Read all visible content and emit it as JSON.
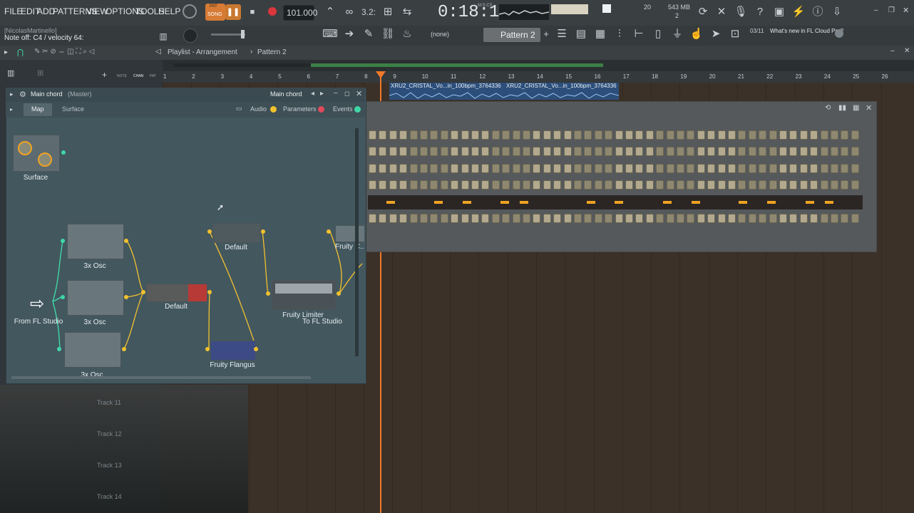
{
  "menu": [
    "FILE",
    "EDIT",
    "ADD",
    "PATTERNS",
    "VIEW",
    "OPTIONS",
    "TOOLS",
    "HELP"
  ],
  "transport": {
    "mode_pat": "PAT",
    "mode_song": "SONG",
    "tempo": "101.000",
    "time": "0:18:10",
    "time_unit": "M:S:CS",
    "cpu_top": "20",
    "mem": "543 MB",
    "mem_sub": "2",
    "pattern_sel": "(none)",
    "pattern": "Pattern 2",
    "step": "3.2:"
  },
  "hint": {
    "user": "[NicolasMartinello]",
    "text": "Note off: C4 / velocity 64:"
  },
  "news": {
    "date": "03/11",
    "text": "What's new in FL Cloud Pro?"
  },
  "playlist": {
    "title": "Playlist - Arrangement",
    "sep": "›",
    "pattern": "Pattern 2",
    "ruler": [
      "1",
      "2",
      "3",
      "4",
      "5",
      "6",
      "7",
      "8",
      "9",
      "10",
      "11",
      "12",
      "13",
      "14",
      "15",
      "16",
      "17",
      "18",
      "19",
      "20",
      "21",
      "22",
      "23",
      "24",
      "25",
      "26"
    ],
    "clip1": "XRU2_CRISTAL_Vo...in_100bpm_3764336",
    "clip2": "XRU2_CRISTAL_Vo...in_100bpm_3764336",
    "left_icons": [
      "NOTE",
      "CHAN",
      "PAT"
    ],
    "tracks": [
      "Track 11",
      "Track 12",
      "Track 13",
      "Track 14"
    ]
  },
  "patcher": {
    "title": "Main chord",
    "title_sub": "(Master)",
    "preset": "Main chord",
    "tab_map": "Map",
    "tab_surface": "Surface",
    "toggle_audio": "Audio",
    "toggle_params": "Parameters",
    "toggle_events": "Events",
    "nodes": {
      "surface": "Surface",
      "osc1": "3x Osc",
      "osc2": "3x Osc",
      "osc3": "3x Osc",
      "from": "From FL Studio",
      "default1": "Default",
      "default2": "Default",
      "flangus": "Fruity Flangus",
      "limiter": "Fruity Limiter",
      "to": "To FL Studio",
      "fruity_cut": "Fruity C..."
    }
  },
  "colors": {
    "accent": "#f0a321",
    "port": "#f2c12e",
    "port_green": "#3fd7a6",
    "topbar": "#3a3f42",
    "playhead": "#f07a2b"
  }
}
